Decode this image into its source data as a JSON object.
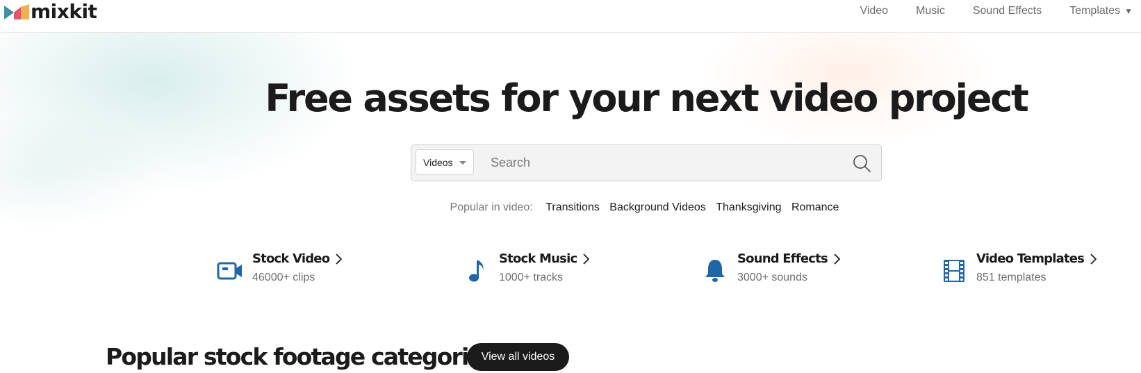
{
  "header": {
    "logo_text": "mixkit",
    "nav": [
      {
        "label": "Video"
      },
      {
        "label": "Music"
      },
      {
        "label": "Sound Effects"
      },
      {
        "label": "Templates"
      }
    ]
  },
  "hero": {
    "title": "Free assets for your next video project",
    "search": {
      "type_selected": "Videos",
      "placeholder": "Search"
    },
    "popular": {
      "label": "Popular in video:",
      "tags": [
        "Transitions",
        "Background Videos",
        "Thanksgiving",
        "Romance"
      ]
    }
  },
  "categories": [
    {
      "title": "Stock Video",
      "subtitle": "46000+ clips",
      "icon": "video-camera-icon"
    },
    {
      "title": "Stock Music",
      "subtitle": "1000+ tracks",
      "icon": "music-note-icon"
    },
    {
      "title": "Sound Effects",
      "subtitle": "3000+ sounds",
      "icon": "bell-icon"
    },
    {
      "title": "Video Templates",
      "subtitle": "851 templates",
      "icon": "film-strip-icon"
    }
  ],
  "section": {
    "title": "Popular stock footage categories",
    "button_label": "View all videos"
  },
  "colors": {
    "icon_blue": "#1f66a8",
    "dark": "#1b1b1b",
    "muted": "#6e6e6e"
  }
}
